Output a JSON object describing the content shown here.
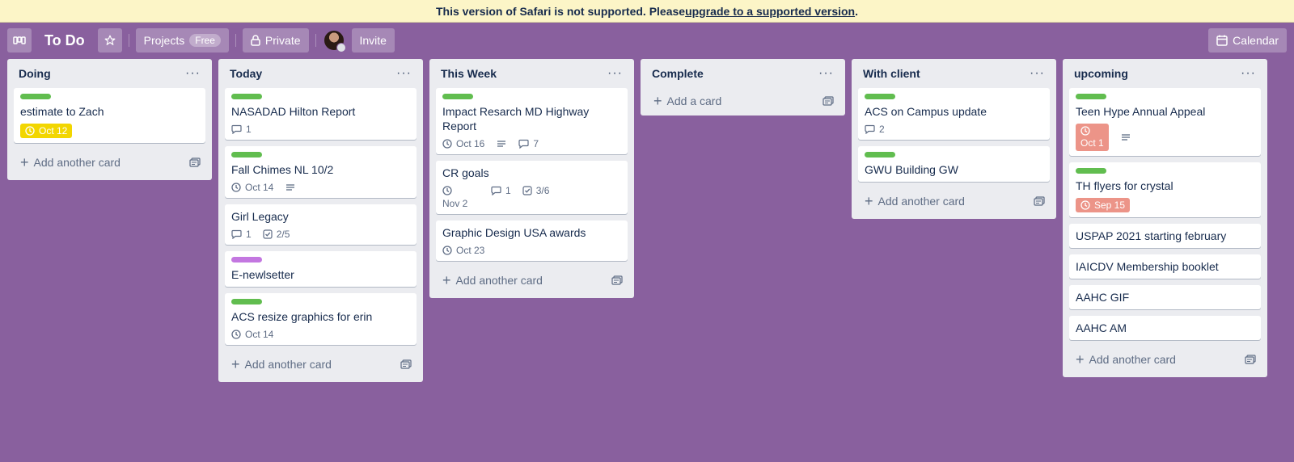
{
  "banner": {
    "text": "This version of Safari is not supported. Please ",
    "link": "upgrade to a supported version",
    "suffix": "."
  },
  "header": {
    "title": "To Do",
    "projects_label": "Projects",
    "projects_badge": "Free",
    "privacy_label": "Private",
    "invite_label": "Invite",
    "calendar_label": "Calendar"
  },
  "colors": {
    "board_bg": "#89609e",
    "green_label": "#61bd4f",
    "purple_label": "#c377e0",
    "due_yellow": "#f2d600",
    "due_red": "#ec9488"
  },
  "lists": [
    {
      "title": "Doing",
      "add": "Add another card",
      "cards": [
        {
          "title": "estimate to Zach",
          "label": "green",
          "due": "Oct 12",
          "due_style": "yellow"
        }
      ]
    },
    {
      "title": "Today",
      "add": "Add another card",
      "cards": [
        {
          "title": "NASADAD Hilton Report",
          "label": "green",
          "comments": "1"
        },
        {
          "title": "Fall Chimes NL 10/2",
          "label": "green",
          "due": "Oct 14",
          "description": true
        },
        {
          "title": "Girl Legacy",
          "comments": "1",
          "checklist": "2/5"
        },
        {
          "title": "E-newlsetter",
          "label": "purple"
        },
        {
          "title": "ACS resize graphics for erin",
          "label": "green",
          "due": "Oct 14"
        }
      ]
    },
    {
      "title": "This Week",
      "add": "Add another card",
      "cards": [
        {
          "title": "Impact Resarch MD Highway Report",
          "label": "green",
          "due": "Oct 16",
          "description": true,
          "comments": "7"
        },
        {
          "title": "CR goals",
          "due_icon_only": true,
          "comments": "1",
          "checklist": "3/6",
          "extra_date": "Nov 2"
        },
        {
          "title": "Graphic Design USA awards",
          "due": "Oct 23"
        }
      ]
    },
    {
      "title": "Complete",
      "add": "Add a card",
      "cards": []
    },
    {
      "title": "With client",
      "add": "Add another card",
      "cards": [
        {
          "title": "ACS on Campus update",
          "label": "green",
          "comments": "2"
        },
        {
          "title": "GWU Building GW",
          "label": "green"
        }
      ]
    },
    {
      "title": "upcoming",
      "add": "Add another card",
      "cards": [
        {
          "title": "Teen Hype Annual Appeal",
          "label": "green",
          "due": "Oct 1",
          "due_style": "red-tall",
          "description": true
        },
        {
          "title": "TH flyers for crystal",
          "label": "green",
          "due": "Sep 15",
          "due_style": "red"
        },
        {
          "title": "USPAP 2021 starting february"
        },
        {
          "title": "IAICDV Membership booklet"
        },
        {
          "title": "AAHC GIF"
        },
        {
          "title": "AAHC AM"
        }
      ]
    }
  ]
}
